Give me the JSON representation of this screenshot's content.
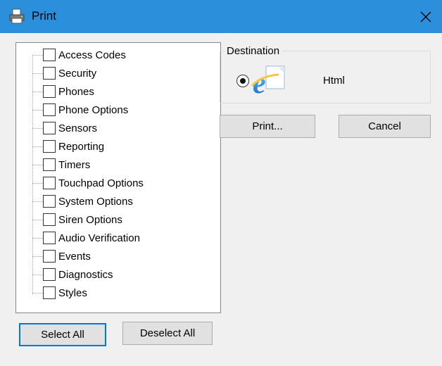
{
  "window": {
    "title": "Print",
    "icon": "printer-icon",
    "close_icon": "close-icon"
  },
  "tree": {
    "items": [
      {
        "label": "Access Codes",
        "checked": false
      },
      {
        "label": "Security",
        "checked": false
      },
      {
        "label": "Phones",
        "checked": false
      },
      {
        "label": "Phone Options",
        "checked": false
      },
      {
        "label": "Sensors",
        "checked": false
      },
      {
        "label": "Reporting",
        "checked": false
      },
      {
        "label": "Timers",
        "checked": false
      },
      {
        "label": "Touchpad Options",
        "checked": false
      },
      {
        "label": "System Options",
        "checked": false
      },
      {
        "label": "Siren Options",
        "checked": false
      },
      {
        "label": "Audio Verification",
        "checked": false
      },
      {
        "label": "Events",
        "checked": false
      },
      {
        "label": "Diagnostics",
        "checked": false
      },
      {
        "label": "Styles",
        "checked": false
      }
    ]
  },
  "buttons": {
    "select_all": "Select All",
    "deselect_all": "Deselect All",
    "print": "Print...",
    "cancel": "Cancel"
  },
  "destination": {
    "title": "Destination",
    "option_label": "Html",
    "selected": true,
    "icon": "internet-explorer-icon"
  },
  "colors": {
    "titlebar": "#2b8fdc",
    "accent": "#0078d7",
    "background": "#f0f0f0"
  }
}
